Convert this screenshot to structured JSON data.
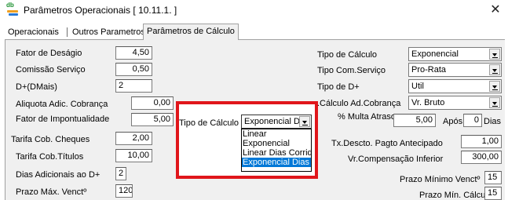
{
  "window": {
    "title": "Parâmetros Operacionais [ 10.11.1. ]",
    "app_icon_text": "db"
  },
  "tabs": [
    {
      "label": "Operacionais"
    },
    {
      "label": "Outros Parametros"
    },
    {
      "label": "Parâmetros de Cálculo"
    }
  ],
  "left": {
    "fator_desagio": {
      "label": "Fator de Deságio",
      "value": "4,50"
    },
    "comissao": {
      "label": "Comissão Serviço",
      "value": "0,50"
    },
    "d_dmais": {
      "label": "D+(DMais)",
      "value": "2"
    },
    "aliquota": {
      "label": "Aliquota Adic. Cobrança",
      "value": "0,00"
    },
    "impontualidade": {
      "label": "Fator de Impontualidade",
      "value": "5,00"
    },
    "tarifa_cheques": {
      "label": "Tarifa Cob. Cheques",
      "value": "2,00"
    },
    "tarifa_titulos": {
      "label": "Tarifa Cob.Títulos",
      "value": "10,00"
    },
    "dias_adicionais": {
      "label": "Dias Adicionais ao D+",
      "value": "2"
    },
    "prazo_max": {
      "label": "Prazo Máx. Venctº",
      "value": "120"
    }
  },
  "right": {
    "tipo_calculo": {
      "label": "Tipo de Cálculo",
      "value": "Exponencial"
    },
    "tipo_com_servico": {
      "label": "Tipo Com.Serviço",
      "value": "Pro-Rata"
    },
    "tipo_d": {
      "label": "Tipo de D+",
      "value": "Util"
    },
    "calculo_ad": {
      "label": ".Cálculo Ad.Cobrança",
      "value": "Vr. Bruto"
    },
    "multa_atraso": {
      "label": "% Multa Atraso",
      "value": "5,00",
      "apos_label": "Após",
      "dias_value": "0",
      "dias_label": "Dias"
    },
    "tx_descto": {
      "label": "Tx.Descto. Pagto Antecipado",
      "value": "1,00"
    },
    "vr_compensacao": {
      "label": "Vr.Compensação Inferior",
      "value": "300,00"
    },
    "prazo_min_venct": {
      "label": "Prazo Mínimo Venctº",
      "value": "15"
    },
    "prazo_min_calculo": {
      "label": "Prazo Mín. Cálculo",
      "value": "15"
    }
  },
  "overlay": {
    "label": "Tipo de Cálculo",
    "combo_value": "Exponencial  D",
    "options": [
      "Linear",
      "Exponencial",
      "Linear Dias Corrido",
      "Exponencial  Dias"
    ],
    "selected_index": 3,
    "highlight_color": "#e0161b",
    "selection_color": "#0078d7"
  }
}
